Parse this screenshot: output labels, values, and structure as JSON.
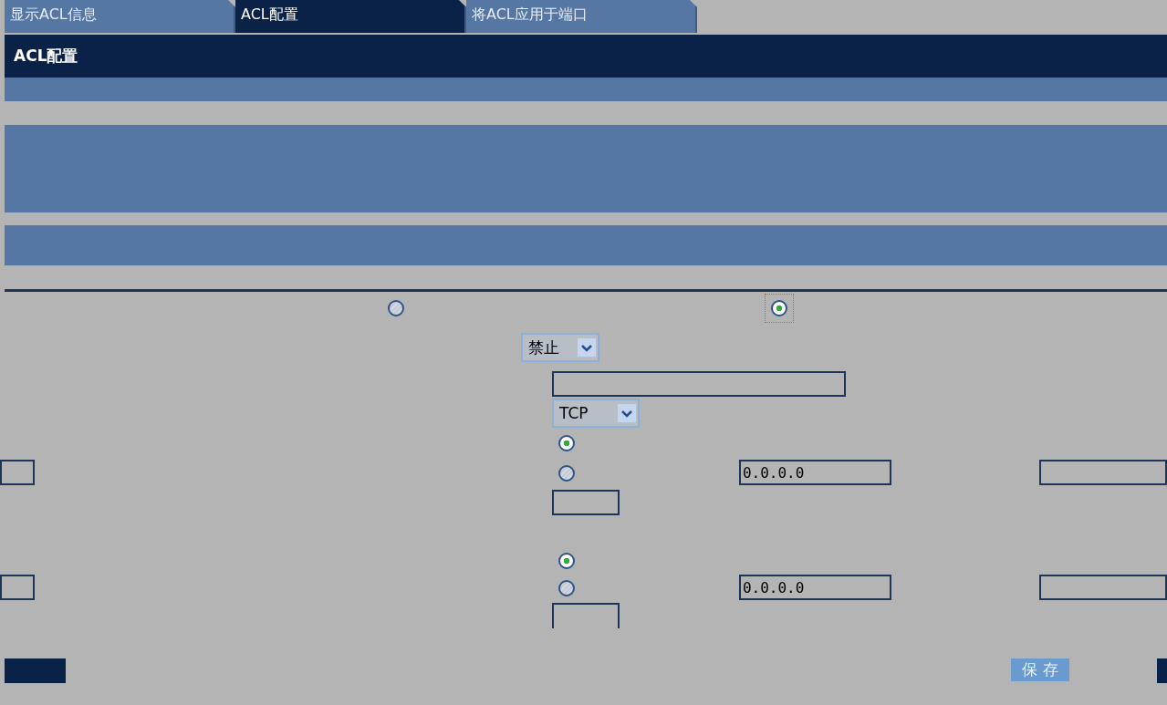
{
  "tabs": [
    {
      "label": "显示ACL信息",
      "selected": false
    },
    {
      "label": "ACL配置",
      "selected": true
    },
    {
      "label": "将ACL应用于端口",
      "selected": false
    }
  ],
  "section_title": "ACL配置",
  "mode_radios": [
    {
      "selected": false
    },
    {
      "selected": true
    }
  ],
  "action_select": {
    "value": "禁止"
  },
  "protocol_select": {
    "value": "TCP"
  },
  "source": {
    "radios": [
      {
        "selected": true
      },
      {
        "selected": false,
        "address": "0.0.0.0"
      }
    ]
  },
  "destination": {
    "radios": [
      {
        "selected": true
      },
      {
        "selected": false,
        "address": "0.0.0.0"
      }
    ]
  },
  "save_button": "保 存"
}
